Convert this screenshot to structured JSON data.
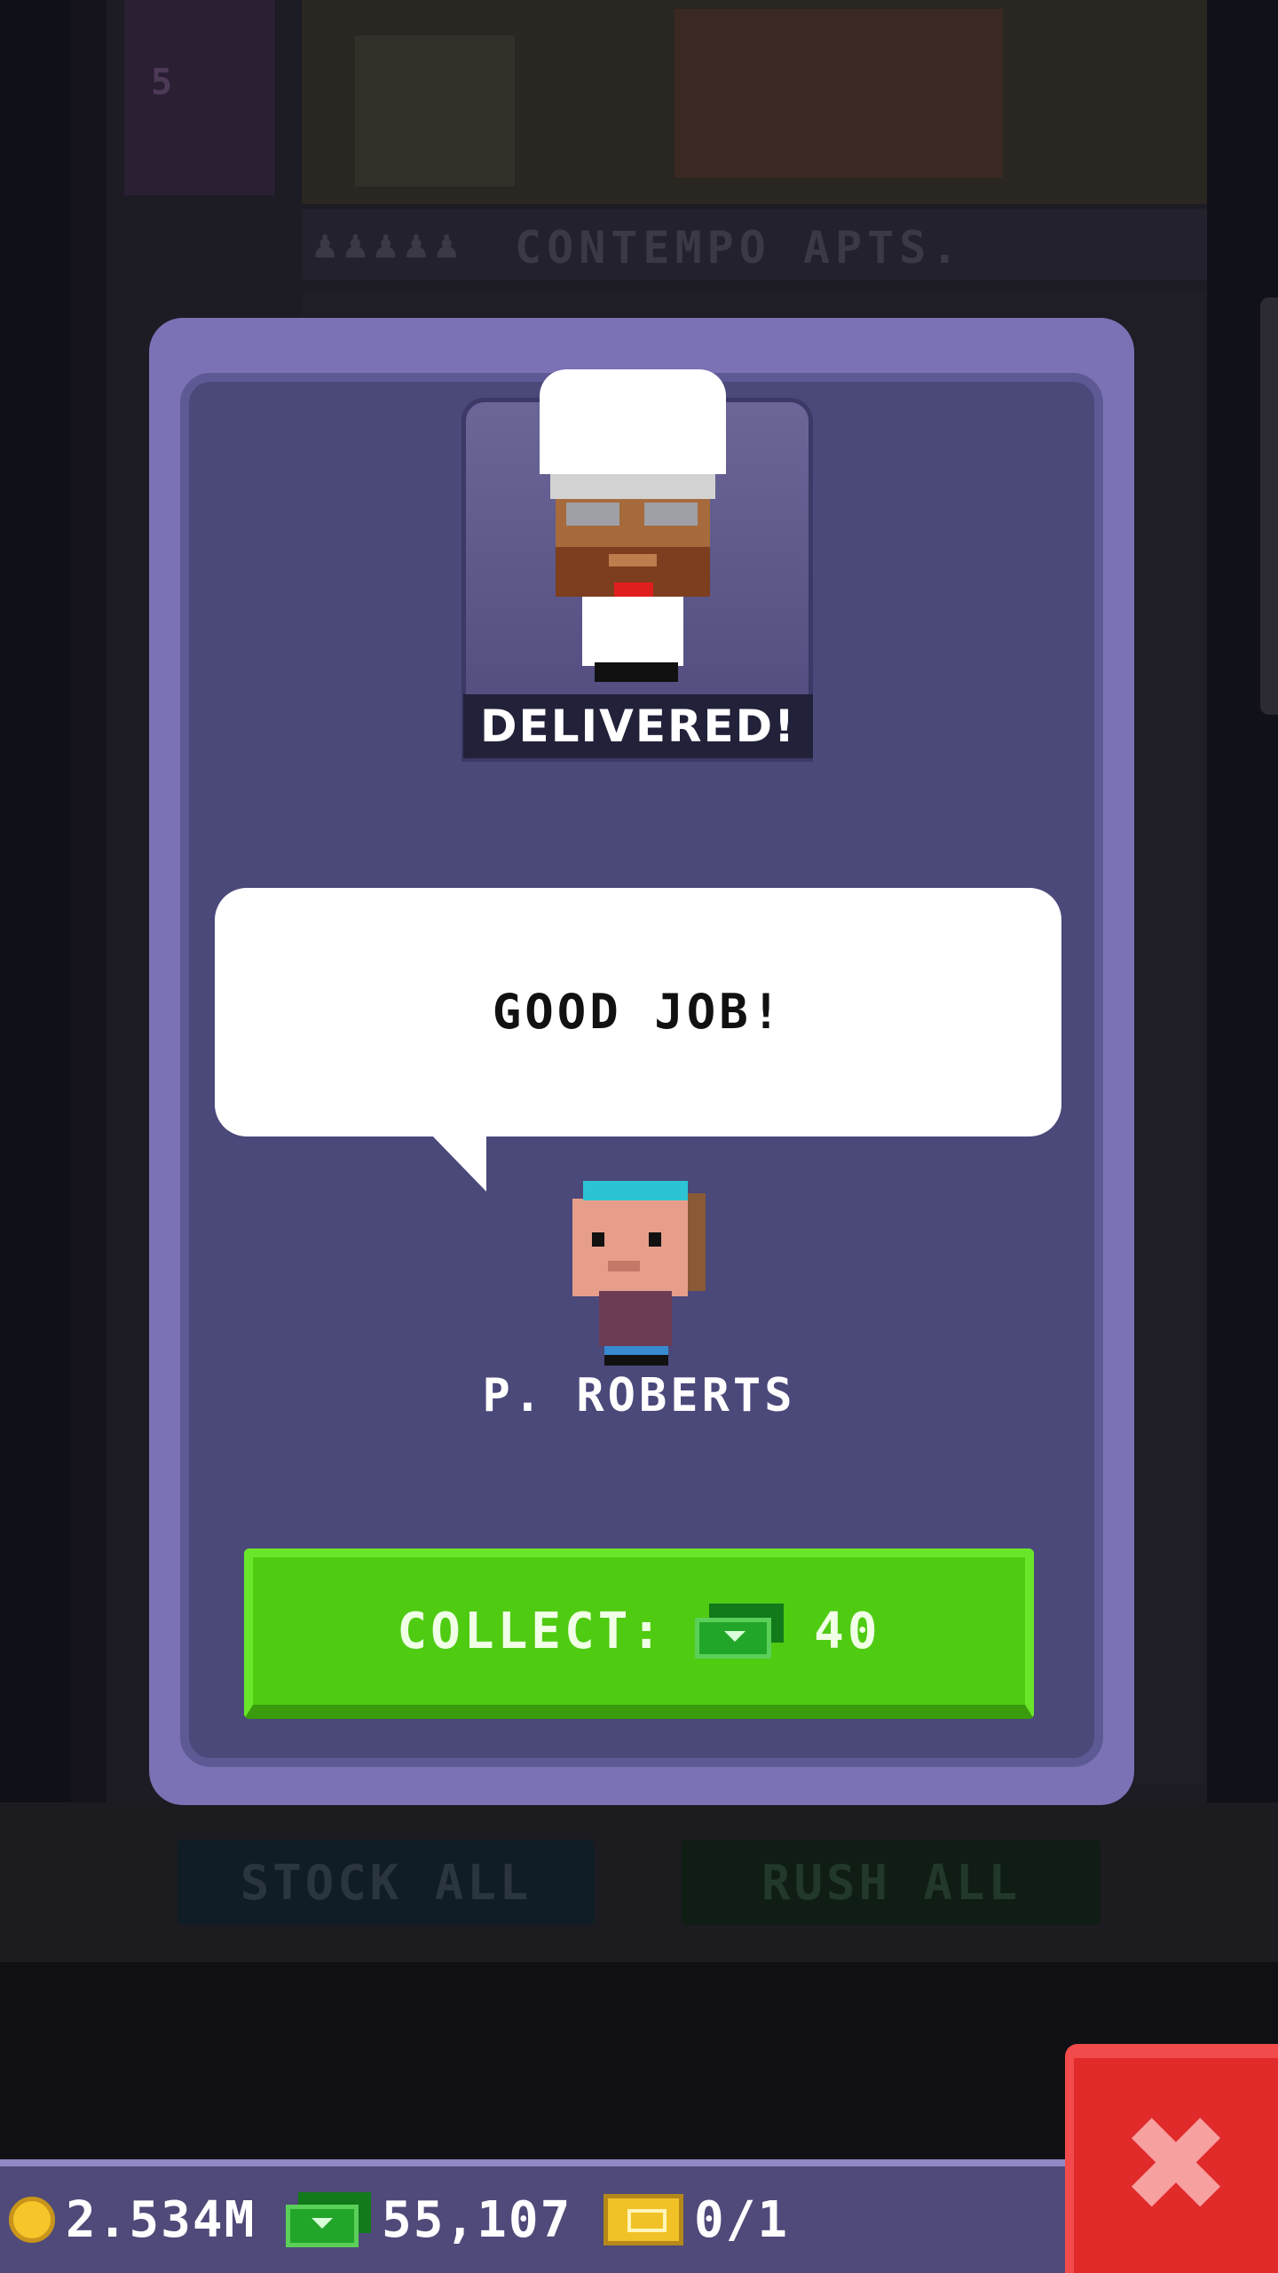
{
  "background": {
    "elevator_floor": "5",
    "floor_label": "CONTEMPO APTS.",
    "floor_label_dots": "♟♟♟♟♟",
    "buttons": {
      "stock_all": "STOCK ALL",
      "rush_all": "RUSH ALL"
    }
  },
  "modal": {
    "status": "DELIVERED!",
    "speech": "GOOD JOB!",
    "npc_name": "P. ROBERTS",
    "collect": {
      "label": "COLLECT:",
      "amount": "40",
      "currency_icon": "bux-icon"
    }
  },
  "hud": {
    "coins": "2.534M",
    "bux": "55,107",
    "tickets": "0/1"
  },
  "colors": {
    "modal_outer": "#7a72b4",
    "modal_inner": "#4b487a",
    "collect_green": "#4fcb12",
    "close_red": "#e12a2a"
  }
}
